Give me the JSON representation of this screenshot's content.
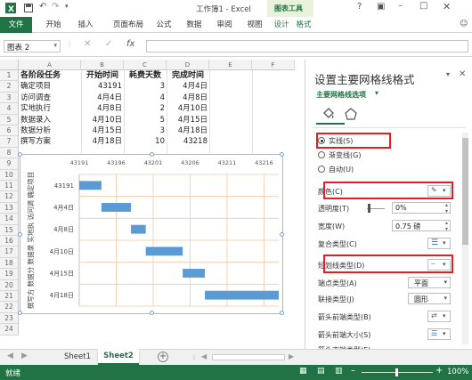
{
  "app": {
    "title": "工作簿1 - Excel",
    "context_group": "图表工具",
    "accent": "#217346",
    "context_color": "#b4d38a"
  },
  "ribbon": {
    "tabs": [
      "文件",
      "开始",
      "插入",
      "页面布局",
      "公式",
      "数据",
      "审阅",
      "视图",
      "设计",
      "格式"
    ]
  },
  "formula_bar": {
    "name_box": "图表 2",
    "cancel": "✕",
    "enter": "✓",
    "fx": "fx",
    "value": ""
  },
  "columns": [
    "A",
    "B",
    "C",
    "D",
    "E",
    "F"
  ],
  "rows": [
    "1",
    "2",
    "3",
    "4",
    "5",
    "6",
    "7",
    "8",
    "9",
    "10",
    "11",
    "12",
    "13",
    "14",
    "15",
    "16",
    "17",
    "18",
    "19",
    "20",
    "21",
    "22",
    "23",
    "24"
  ],
  "table": {
    "headers": [
      "各阶段任务",
      "开始时间",
      "耗费天数",
      "完成时间"
    ],
    "rows": [
      [
        "确定项目",
        "43191",
        "3",
        "4月4日"
      ],
      [
        "访问调查",
        "4月4日",
        "4",
        "4月8日"
      ],
      [
        "实地执行",
        "4月8日",
        "2",
        "4月10日"
      ],
      [
        "数据录入",
        "4月10日",
        "5",
        "4月15日"
      ],
      [
        "数据分析",
        "4月15日",
        "3",
        "4月18日"
      ],
      [
        "撰写方案",
        "4月18日",
        "10",
        "43218"
      ]
    ]
  },
  "chart_data": {
    "type": "bar",
    "orientation": "horizontal",
    "stacked": true,
    "x_ticks": [
      "43191",
      "43196",
      "43201",
      "43206",
      "43211",
      "43216"
    ],
    "xlim": [
      43191,
      43218
    ],
    "categories": [
      "43191",
      "4月4日",
      "4月8日",
      "4月10日",
      "4月15日",
      "4月18日"
    ],
    "left_axis_title": "撰写方 数据分 数据录 实地执 访问调 确定项目",
    "series": [
      {
        "values": [
          43191,
          43194,
          43198,
          43200,
          43205,
          43208
        ],
        "color": "transparent"
      },
      {
        "values": [
          3,
          4,
          2,
          5,
          3,
          10
        ],
        "color": "#5b9bd5"
      }
    ],
    "grid": true
  },
  "panel": {
    "title": "设置主要网格线格式",
    "subtitle": "主要网格线选项",
    "line_options": [
      "实线(S)",
      "渐变线(G)",
      "自动(U)"
    ],
    "selected_option": 0,
    "color_label": "颜色(C)",
    "transparency_label": "透明度(T)",
    "transparency_value": "0%",
    "width_label": "宽度(W)",
    "width_value": "0.75 磅",
    "compound_label": "复合类型(C)",
    "dash_label": "短划线类型(D)",
    "cap_label": "端点类型(A)",
    "cap_value": "平面",
    "join_label": "联接类型(J)",
    "join_value": "圆形",
    "begin_arrow_type": "箭头前端类型(B)",
    "begin_arrow_size": "箭头前端大小(S)",
    "end_arrow_type": "箭头末端类型(E)"
  },
  "sheets": {
    "tabs": [
      "Sheet1",
      "Sheet2"
    ],
    "active": 1,
    "add": "+"
  },
  "status": {
    "text": "就绪",
    "zoom": "100%"
  }
}
